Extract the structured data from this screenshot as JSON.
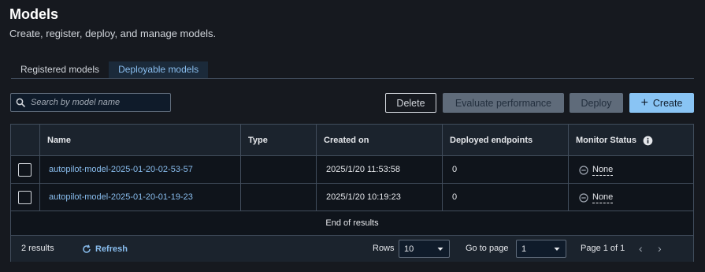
{
  "page": {
    "title": "Models",
    "subtitle": "Create, register, deploy, and manage models."
  },
  "tabs": [
    {
      "label": "Registered models",
      "active": false
    },
    {
      "label": "Deployable models",
      "active": true
    }
  ],
  "search": {
    "placeholder": "Search by model name",
    "value": ""
  },
  "toolbar": {
    "delete_label": "Delete",
    "evaluate_label": "Evaluate performance",
    "deploy_label": "Deploy",
    "create_label": "Create",
    "create_icon": "+"
  },
  "table": {
    "columns": [
      "Name",
      "Type",
      "Created on",
      "Deployed endpoints",
      "Monitor Status"
    ],
    "rows": [
      {
        "name": "autopilot-model-2025-01-20-02-53-57",
        "type": "",
        "created_on": "2025/1/20 11:53:58",
        "deployed_endpoints": "0",
        "monitor_status": "None"
      },
      {
        "name": "autopilot-model-2025-01-20-01-19-23",
        "type": "",
        "created_on": "2025/1/20 10:19:23",
        "deployed_endpoints": "0",
        "monitor_status": "None"
      }
    ],
    "end_text": "End of results"
  },
  "footer": {
    "results_count": "2 results",
    "refresh_label": "Refresh",
    "rows_label": "Rows",
    "rows_value": "10",
    "go_to_page_label": "Go to page",
    "page_value": "1",
    "page_info": "Page 1 of 1",
    "prev_icon": "‹",
    "next_icon": "›"
  },
  "colors": {
    "background": "#16191f",
    "link": "#89bdee",
    "primary_button": "#89c4f4",
    "disabled_button": "#5f6b7a"
  }
}
